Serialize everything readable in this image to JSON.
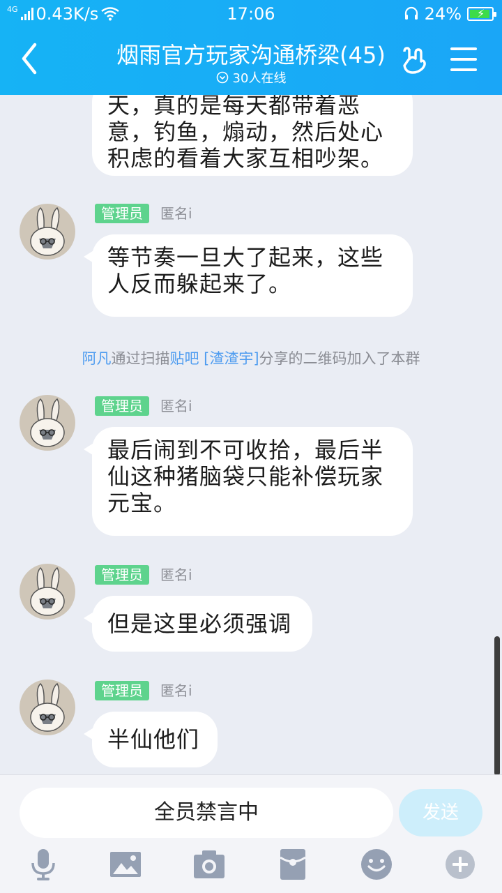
{
  "status": {
    "network_type": "4G",
    "speed": "0.43K/s",
    "time": "17:06",
    "battery": "24%"
  },
  "header": {
    "title": "烟雨官方玩家沟通桥梁(45)",
    "online": "30人在线"
  },
  "messages": {
    "m1": {
      "lines": [
        "天，真的是每天都带着恶",
        "意，钓鱼，煽动，然后处心",
        "积虑的看着大家互相吵架。"
      ]
    },
    "m2": {
      "badge": "管理员",
      "nick": "匿名i",
      "lines": [
        "等节奏一旦大了起来，这些",
        "人反而躲起来了。"
      ]
    },
    "system": {
      "user": "阿凡",
      "text1": "通过扫描",
      "source": "贴吧",
      "sharer": "[渣渣宇]",
      "text2": "分享的二维码加入了本群"
    },
    "m3": {
      "badge": "管理员",
      "nick": "匿名i",
      "lines": [
        "最后闹到不可收拾，最后半",
        "仙这种猪脑袋只能补偿玩家",
        "元宝。"
      ]
    },
    "m4": {
      "badge": "管理员",
      "nick": "匿名i",
      "lines": [
        "但是这里必须强调"
      ]
    },
    "m5": {
      "badge": "管理员",
      "nick": "匿名i",
      "lines": [
        "半仙他们"
      ]
    }
  },
  "input": {
    "mute_text": "全员禁言中",
    "send_label": "发送"
  },
  "toolbar": [
    "microphone-icon",
    "image-icon",
    "camera-icon",
    "red-packet-icon",
    "emoji-icon",
    "plus-icon"
  ],
  "colors": {
    "header": "#1aa6f7",
    "background": "#eaedf4",
    "admin_badge": "#5ed38d",
    "link": "#4e9cf0",
    "send_disabled": "#cdeefb"
  }
}
